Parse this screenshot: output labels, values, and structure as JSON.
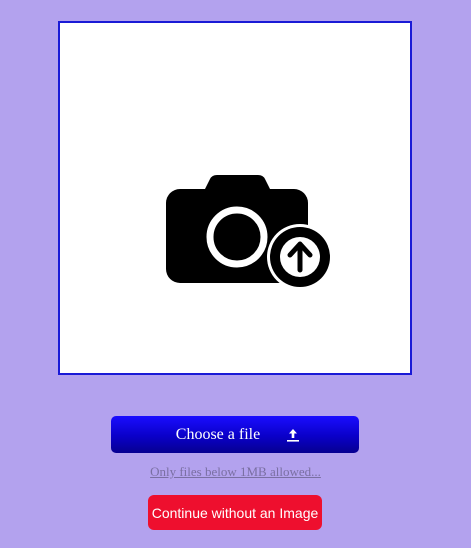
{
  "preview": {
    "icon": "camera-upload-icon"
  },
  "upload": {
    "choose_label": "Choose a file",
    "icon": "upload-arrow-icon",
    "note": "Only files below 1MB allowed..."
  },
  "actions": {
    "continue_label": "Continue without an Image"
  },
  "colors": {
    "background": "#b3a2ee",
    "preview_border": "#1a1ad6",
    "choose_button": "#0a00c8",
    "continue_button": "#ee0f2e"
  }
}
